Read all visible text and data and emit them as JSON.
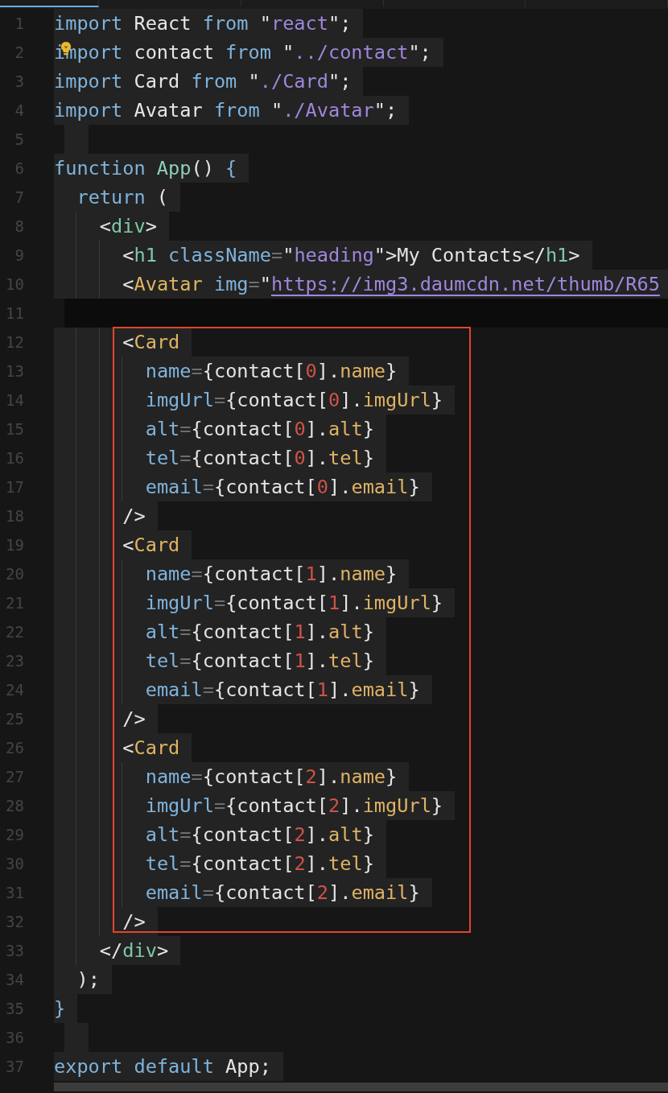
{
  "tabs": [
    {
      "selected": true
    },
    {
      "selected": false
    },
    {
      "selected": false
    },
    {
      "selected": false
    },
    {
      "selected": false
    }
  ],
  "lines": [
    {
      "kind": "code",
      "number": "1",
      "tokens": [
        {
          "kind": "kw",
          "text": "import "
        },
        {
          "kind": "id",
          "text": "React "
        },
        {
          "kind": "kw",
          "text": "from "
        },
        {
          "kind": "p",
          "text": "\""
        },
        {
          "kind": "str",
          "text": "react"
        },
        {
          "kind": "p",
          "text": "\";"
        }
      ]
    },
    {
      "kind": "hint",
      "number": "2",
      "tokens": [
        {
          "kind": "kw",
          "text": "import "
        },
        {
          "kind": "id",
          "text": "contact "
        },
        {
          "kind": "kw",
          "text": "from "
        },
        {
          "kind": "p",
          "text": "\""
        },
        {
          "kind": "str",
          "text": "../contact"
        },
        {
          "kind": "p",
          "text": "\";"
        }
      ]
    },
    {
      "kind": "code",
      "number": "3",
      "tokens": [
        {
          "kind": "kw",
          "text": "import "
        },
        {
          "kind": "id",
          "text": "Card "
        },
        {
          "kind": "kw",
          "text": "from "
        },
        {
          "kind": "p",
          "text": "\""
        },
        {
          "kind": "str",
          "text": "./Card"
        },
        {
          "kind": "p",
          "text": "\";"
        }
      ]
    },
    {
      "kind": "code",
      "number": "4",
      "tokens": [
        {
          "kind": "kw",
          "text": "import "
        },
        {
          "kind": "id",
          "text": "Avatar "
        },
        {
          "kind": "kw",
          "text": "from "
        },
        {
          "kind": "p",
          "text": "\""
        },
        {
          "kind": "str",
          "text": "./Avatar"
        },
        {
          "kind": "p",
          "text": "\";"
        }
      ]
    },
    {
      "kind": "empty",
      "number": "5"
    },
    {
      "kind": "code",
      "number": "6",
      "tokens": [
        {
          "kind": "kw",
          "text": "function "
        },
        {
          "kind": "fn",
          "text": "App"
        },
        {
          "kind": "p",
          "text": "() "
        },
        {
          "kind": "kw",
          "text": "{"
        }
      ]
    },
    {
      "kind": "code",
      "number": "7",
      "tokens": [
        {
          "kind": "kw",
          "text": "  return "
        },
        {
          "kind": "p",
          "text": "("
        }
      ]
    },
    {
      "kind": "code",
      "number": "8",
      "tokens": [
        {
          "kind": "p",
          "text": "    <"
        },
        {
          "kind": "tag",
          "text": "div"
        },
        {
          "kind": "p",
          "text": ">"
        }
      ]
    },
    {
      "kind": "code",
      "number": "9",
      "tokens": [
        {
          "kind": "p",
          "text": "      <"
        },
        {
          "kind": "tag",
          "text": "h1 "
        },
        {
          "kind": "attr",
          "text": "className"
        },
        {
          "kind": "op",
          "text": "="
        },
        {
          "kind": "p",
          "text": "\""
        },
        {
          "kind": "str",
          "text": "heading"
        },
        {
          "kind": "p",
          "text": "\">My Contacts</"
        },
        {
          "kind": "tag",
          "text": "h1"
        },
        {
          "kind": "p",
          "text": ">"
        }
      ]
    },
    {
      "kind": "code",
      "number": "10",
      "tokens": [
        {
          "kind": "p",
          "text": "      <"
        },
        {
          "kind": "comp",
          "text": "Avatar "
        },
        {
          "kind": "attr",
          "text": "img"
        },
        {
          "kind": "op",
          "text": "="
        },
        {
          "kind": "p",
          "text": "\""
        },
        {
          "kind": "url",
          "text": "https://img3.daumcdn.net/thumb/R65"
        }
      ]
    },
    {
      "kind": "current",
      "number": "11"
    },
    {
      "kind": "frame",
      "lines": [
        {
          "kind": "code",
          "number": "12",
          "tokens": [
            {
              "kind": "p",
              "text": "      <"
            },
            {
              "kind": "comp",
              "text": "Card"
            }
          ]
        },
        {
          "kind": "code",
          "number": "13",
          "tokens": [
            {
              "kind": "attr",
              "text": "        name"
            },
            {
              "kind": "op",
              "text": "="
            },
            {
              "kind": "p",
              "text": "{contact["
            },
            {
              "kind": "num",
              "text": "0"
            },
            {
              "kind": "p",
              "text": "]."
            },
            {
              "kind": "prop",
              "text": "name"
            },
            {
              "kind": "p",
              "text": "}"
            }
          ]
        },
        {
          "kind": "code",
          "number": "14",
          "tokens": [
            {
              "kind": "attr",
              "text": "        imgUrl"
            },
            {
              "kind": "op",
              "text": "="
            },
            {
              "kind": "p",
              "text": "{contact["
            },
            {
              "kind": "num",
              "text": "0"
            },
            {
              "kind": "p",
              "text": "]."
            },
            {
              "kind": "prop",
              "text": "imgUrl"
            },
            {
              "kind": "p",
              "text": "}"
            }
          ]
        },
        {
          "kind": "code",
          "number": "15",
          "tokens": [
            {
              "kind": "attr",
              "text": "        alt"
            },
            {
              "kind": "op",
              "text": "="
            },
            {
              "kind": "p",
              "text": "{contact["
            },
            {
              "kind": "num",
              "text": "0"
            },
            {
              "kind": "p",
              "text": "]."
            },
            {
              "kind": "prop",
              "text": "alt"
            },
            {
              "kind": "p",
              "text": "}"
            }
          ]
        },
        {
          "kind": "code",
          "number": "16",
          "tokens": [
            {
              "kind": "attr",
              "text": "        tel"
            },
            {
              "kind": "op",
              "text": "="
            },
            {
              "kind": "p",
              "text": "{contact["
            },
            {
              "kind": "num",
              "text": "0"
            },
            {
              "kind": "p",
              "text": "]."
            },
            {
              "kind": "prop",
              "text": "tel"
            },
            {
              "kind": "p",
              "text": "}"
            }
          ]
        },
        {
          "kind": "code",
          "number": "17",
          "tokens": [
            {
              "kind": "attr",
              "text": "        email"
            },
            {
              "kind": "op",
              "text": "="
            },
            {
              "kind": "p",
              "text": "{contact["
            },
            {
              "kind": "num",
              "text": "0"
            },
            {
              "kind": "p",
              "text": "]."
            },
            {
              "kind": "prop",
              "text": "email"
            },
            {
              "kind": "p",
              "text": "}"
            }
          ]
        },
        {
          "kind": "code",
          "number": "18",
          "tokens": [
            {
              "kind": "p",
              "text": "      />"
            }
          ]
        },
        {
          "kind": "code",
          "number": "19",
          "tokens": [
            {
              "kind": "p",
              "text": "      <"
            },
            {
              "kind": "comp",
              "text": "Card"
            }
          ]
        },
        {
          "kind": "code",
          "number": "20",
          "tokens": [
            {
              "kind": "attr",
              "text": "        name"
            },
            {
              "kind": "op",
              "text": "="
            },
            {
              "kind": "p",
              "text": "{contact["
            },
            {
              "kind": "num",
              "text": "1"
            },
            {
              "kind": "p",
              "text": "]."
            },
            {
              "kind": "prop",
              "text": "name"
            },
            {
              "kind": "p",
              "text": "}"
            }
          ]
        },
        {
          "kind": "code",
          "number": "21",
          "tokens": [
            {
              "kind": "attr",
              "text": "        imgUrl"
            },
            {
              "kind": "op",
              "text": "="
            },
            {
              "kind": "p",
              "text": "{contact["
            },
            {
              "kind": "num",
              "text": "1"
            },
            {
              "kind": "p",
              "text": "]."
            },
            {
              "kind": "prop",
              "text": "imgUrl"
            },
            {
              "kind": "p",
              "text": "}"
            }
          ]
        },
        {
          "kind": "code",
          "number": "22",
          "tokens": [
            {
              "kind": "attr",
              "text": "        alt"
            },
            {
              "kind": "op",
              "text": "="
            },
            {
              "kind": "p",
              "text": "{contact["
            },
            {
              "kind": "num",
              "text": "1"
            },
            {
              "kind": "p",
              "text": "]."
            },
            {
              "kind": "prop",
              "text": "alt"
            },
            {
              "kind": "p",
              "text": "}"
            }
          ]
        },
        {
          "kind": "code",
          "number": "23",
          "tokens": [
            {
              "kind": "attr",
              "text": "        tel"
            },
            {
              "kind": "op",
              "text": "="
            },
            {
              "kind": "p",
              "text": "{contact["
            },
            {
              "kind": "num",
              "text": "1"
            },
            {
              "kind": "p",
              "text": "]."
            },
            {
              "kind": "prop",
              "text": "tel"
            },
            {
              "kind": "p",
              "text": "}"
            }
          ]
        },
        {
          "kind": "code",
          "number": "24",
          "tokens": [
            {
              "kind": "attr",
              "text": "        email"
            },
            {
              "kind": "op",
              "text": "="
            },
            {
              "kind": "p",
              "text": "{contact["
            },
            {
              "kind": "num",
              "text": "1"
            },
            {
              "kind": "p",
              "text": "]."
            },
            {
              "kind": "prop",
              "text": "email"
            },
            {
              "kind": "p",
              "text": "}"
            }
          ]
        },
        {
          "kind": "code",
          "number": "25",
          "tokens": [
            {
              "kind": "p",
              "text": "      />"
            }
          ]
        },
        {
          "kind": "code",
          "number": "26",
          "tokens": [
            {
              "kind": "p",
              "text": "      <"
            },
            {
              "kind": "comp",
              "text": "Card"
            }
          ]
        },
        {
          "kind": "code",
          "number": "27",
          "tokens": [
            {
              "kind": "attr",
              "text": "        name"
            },
            {
              "kind": "op",
              "text": "="
            },
            {
              "kind": "p",
              "text": "{contact["
            },
            {
              "kind": "num",
              "text": "2"
            },
            {
              "kind": "p",
              "text": "]."
            },
            {
              "kind": "prop",
              "text": "name"
            },
            {
              "kind": "p",
              "text": "}"
            }
          ]
        },
        {
          "kind": "code",
          "number": "28",
          "tokens": [
            {
              "kind": "attr",
              "text": "        imgUrl"
            },
            {
              "kind": "op",
              "text": "="
            },
            {
              "kind": "p",
              "text": "{contact["
            },
            {
              "kind": "num",
              "text": "2"
            },
            {
              "kind": "p",
              "text": "]."
            },
            {
              "kind": "prop",
              "text": "imgUrl"
            },
            {
              "kind": "p",
              "text": "}"
            }
          ]
        },
        {
          "kind": "code",
          "number": "29",
          "tokens": [
            {
              "kind": "attr",
              "text": "        alt"
            },
            {
              "kind": "op",
              "text": "="
            },
            {
              "kind": "p",
              "text": "{contact["
            },
            {
              "kind": "num",
              "text": "2"
            },
            {
              "kind": "p",
              "text": "]."
            },
            {
              "kind": "prop",
              "text": "alt"
            },
            {
              "kind": "p",
              "text": "}"
            }
          ]
        },
        {
          "kind": "code",
          "number": "30",
          "tokens": [
            {
              "kind": "attr",
              "text": "        tel"
            },
            {
              "kind": "op",
              "text": "="
            },
            {
              "kind": "p",
              "text": "{contact["
            },
            {
              "kind": "num",
              "text": "2"
            },
            {
              "kind": "p",
              "text": "]."
            },
            {
              "kind": "prop",
              "text": "tel"
            },
            {
              "kind": "p",
              "text": "}"
            }
          ]
        },
        {
          "kind": "code",
          "number": "31",
          "tokens": [
            {
              "kind": "attr",
              "text": "        email"
            },
            {
              "kind": "op",
              "text": "="
            },
            {
              "kind": "p",
              "text": "{contact["
            },
            {
              "kind": "num",
              "text": "2"
            },
            {
              "kind": "p",
              "text": "]."
            },
            {
              "kind": "prop",
              "text": "email"
            },
            {
              "kind": "p",
              "text": "}"
            }
          ]
        },
        {
          "kind": "code",
          "number": "32",
          "tokens": [
            {
              "kind": "p",
              "text": "      />"
            }
          ]
        }
      ]
    },
    {
      "kind": "code",
      "number": "33",
      "tokens": [
        {
          "kind": "p",
          "text": "    </"
        },
        {
          "kind": "tag",
          "text": "div"
        },
        {
          "kind": "p",
          "text": ">"
        }
      ]
    },
    {
      "kind": "code",
      "number": "34",
      "tokens": [
        {
          "kind": "p",
          "text": "  );"
        }
      ]
    },
    {
      "kind": "code",
      "number": "35",
      "tokens": [
        {
          "kind": "kw",
          "text": "}"
        }
      ]
    },
    {
      "kind": "empty",
      "number": "36"
    },
    {
      "kind": "code",
      "number": "37",
      "tokens": [
        {
          "kind": "kw",
          "text": "export default "
        },
        {
          "kind": "id",
          "text": "App"
        },
        {
          "kind": "p",
          "text": ";"
        }
      ]
    }
  ]
}
